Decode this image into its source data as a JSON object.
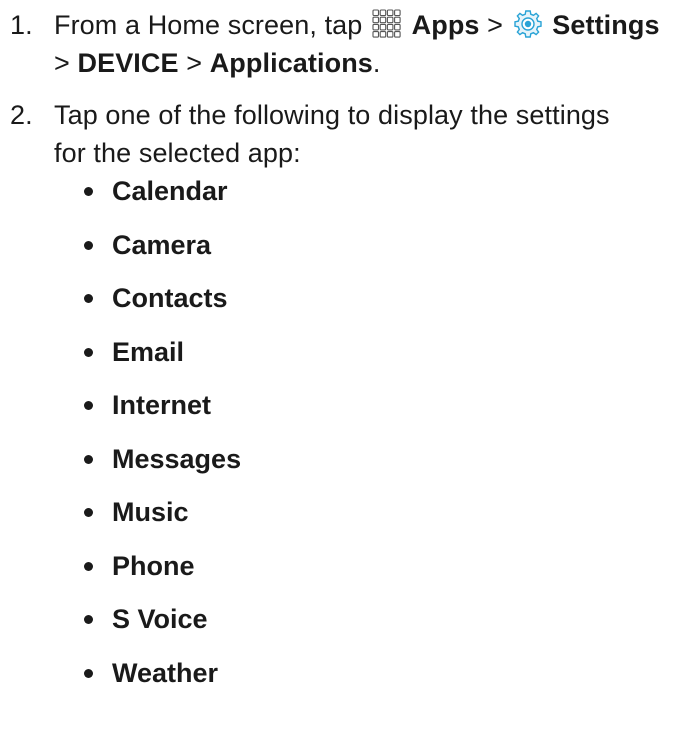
{
  "steps": [
    {
      "number": "1.",
      "text_before": "From a Home screen, tap",
      "apps_icon": "apps-grid-icon",
      "apps_label": "Apps",
      "sep1": ">",
      "settings_icon": "settings-gear-icon",
      "settings_label": "Settings",
      "sep2": ">",
      "device_label": "DEVICE",
      "sep3": ">",
      "applications_label": "Applications",
      "end": "."
    },
    {
      "number": "2.",
      "line1": "Tap one of the following to display the settings",
      "line2": "for the selected app:"
    }
  ],
  "apps": [
    "Calendar",
    "Camera",
    "Contacts",
    "Email",
    "Internet",
    "Messages",
    "Music",
    "Phone",
    "S Voice",
    "Weather"
  ],
  "colors": {
    "text": "#1a1a1a",
    "settings_icon_blue": "#29a3d6"
  }
}
